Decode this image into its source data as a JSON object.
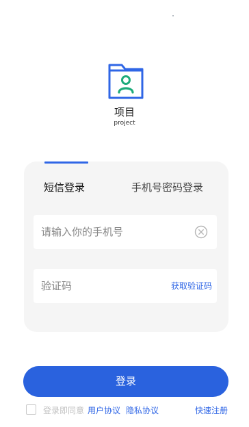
{
  "app": {
    "name": "项目",
    "subtitle": "project"
  },
  "tabs": [
    {
      "label": "短信登录",
      "active": true
    },
    {
      "label": "手机号密码登录",
      "active": false
    }
  ],
  "phone_field": {
    "placeholder": "请输入你的手机号"
  },
  "code_field": {
    "placeholder": "验证码",
    "get_code_label": "获取验证码"
  },
  "login_button": {
    "label": "登录"
  },
  "agreement": {
    "prefix": "登录即同意",
    "user_agreement": "用户协议",
    "privacy_agreement": "隐私协议",
    "checked": false
  },
  "quick_register": "快速注册",
  "colors": {
    "accent": "#2f66e6",
    "button": "#2a62de",
    "card": "#f5f5f5",
    "logo_green": "#1dab7b"
  },
  "icons": {
    "logo": "folder-user-icon",
    "clear": "clear-circle-icon"
  }
}
